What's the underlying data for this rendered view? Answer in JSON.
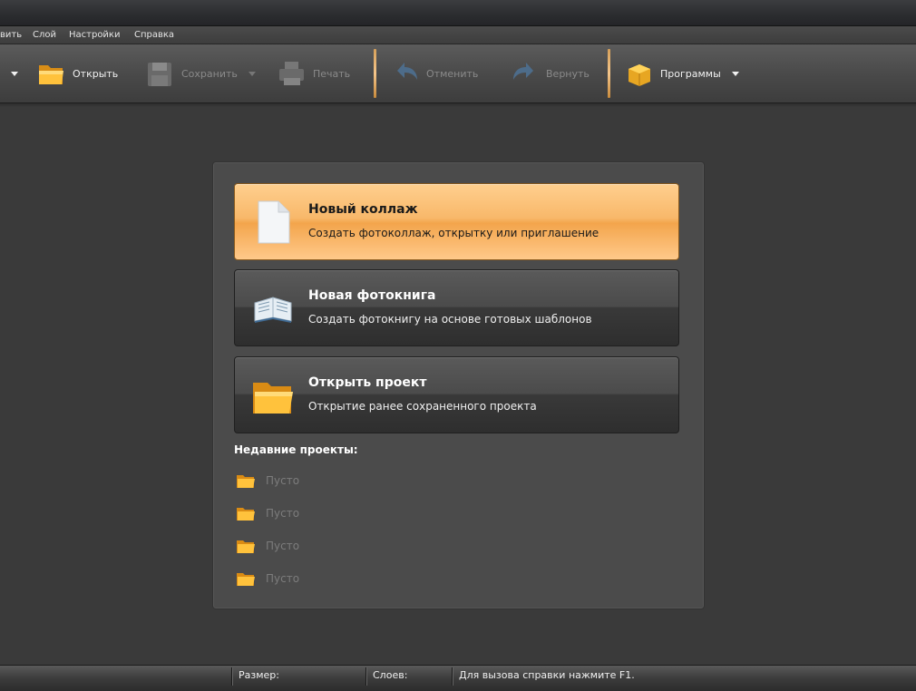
{
  "menu": {
    "items": [
      "вить",
      "Слой",
      "Настройки",
      "Справка"
    ]
  },
  "toolbar": {
    "open_label": "Открыть",
    "save_label": "Сохранить",
    "print_label": "Печать",
    "undo_label": "Отменить",
    "redo_label": "Вернуть",
    "programs_label": "Программы"
  },
  "start": {
    "new_collage": {
      "title": "Новый коллаж",
      "subtitle": "Создать фотоколлаж, открытку или приглашение"
    },
    "new_photobook": {
      "title": "Новая фотокнига",
      "subtitle": "Создать фотокнигу на основе готовых шаблонов"
    },
    "open_project": {
      "title": "Открыть проект",
      "subtitle": "Открытие ранее сохраненного проекта"
    },
    "recent_title": "Недавние проекты:",
    "recent": [
      "Пусто",
      "Пусто",
      "Пусто",
      "Пусто"
    ]
  },
  "status": {
    "size_label": "Размер:",
    "layers_label": "Слоев:",
    "hint": "Для вызова справки нажмите F1."
  },
  "colors": {
    "accent": "#f8b86a",
    "separator": "#f4c58a"
  }
}
